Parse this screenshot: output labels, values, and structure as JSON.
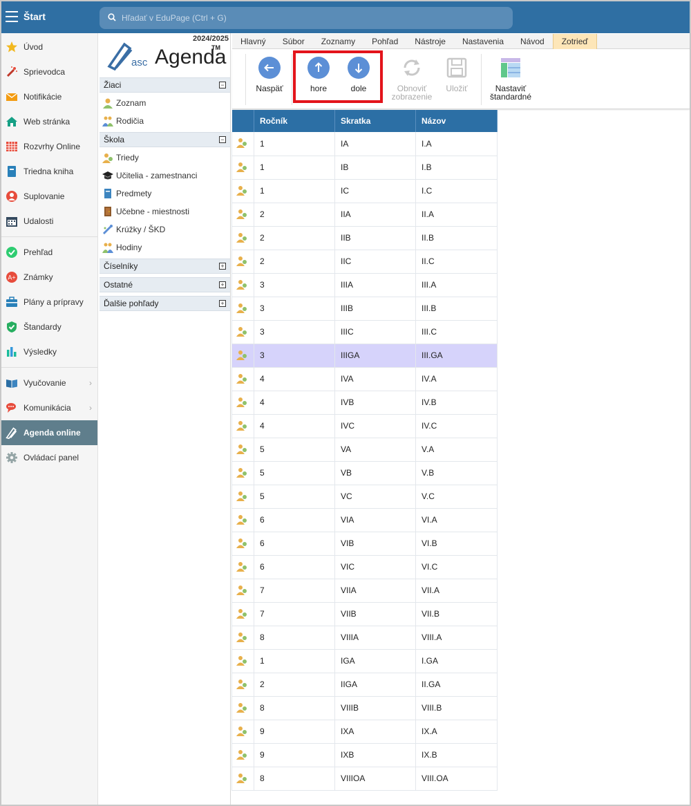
{
  "topbar": {
    "title": "Štart",
    "search_placeholder": "Hľadať v EduPage (Ctrl + G)"
  },
  "leftnav": {
    "items": [
      {
        "label": "Úvod",
        "icon": "star-icon"
      },
      {
        "label": "Sprievodca",
        "icon": "magic-wand-icon"
      },
      {
        "label": "Notifikácie",
        "icon": "envelope-icon"
      },
      {
        "label": "Web stránka",
        "icon": "home-icon"
      },
      {
        "label": "Rozvrhy Online",
        "icon": "grid-calendar-icon"
      },
      {
        "label": "Triedna kniha",
        "icon": "book-icon"
      },
      {
        "label": "Suplovanie",
        "icon": "substitute-person-icon"
      },
      {
        "label": "Udalosti",
        "icon": "calendar-icon"
      },
      {
        "label": "Prehľad",
        "icon": "check-circle-icon"
      },
      {
        "label": "Známky",
        "icon": "grades-icon"
      },
      {
        "label": "Plány a prípravy",
        "icon": "briefcase-icon"
      },
      {
        "label": "Štandardy",
        "icon": "shield-check-icon"
      },
      {
        "label": "Výsledky",
        "icon": "bar-chart-icon"
      },
      {
        "label": "Vyučovanie",
        "icon": "open-book-icon"
      },
      {
        "label": "Komunikácia",
        "icon": "chat-icon"
      },
      {
        "label": "Agenda online",
        "icon": "pen-icon"
      },
      {
        "label": "Ovládací panel",
        "icon": "gear-icon"
      }
    ]
  },
  "agenda": {
    "year": "2024/2025",
    "logo_small": "asc",
    "logo_big": "Agenda",
    "logo_tm": "TM",
    "groups": [
      {
        "label": "Žiaci",
        "toggle": "−"
      },
      {
        "label": "Škola",
        "toggle": "−"
      },
      {
        "label": "Číselníky",
        "toggle": "+"
      },
      {
        "label": "Ostatné",
        "toggle": "+"
      },
      {
        "label": "Ďalšie pohľady",
        "toggle": "+"
      }
    ],
    "ziaci_items": [
      {
        "label": "Zoznam",
        "icon": "student-icon"
      },
      {
        "label": "Rodičia",
        "icon": "parents-icon"
      }
    ],
    "skola_items": [
      {
        "label": "Triedy",
        "icon": "class-icon"
      },
      {
        "label": "Učitelia - zamestnanci",
        "icon": "graduation-cap-icon"
      },
      {
        "label": "Predmety",
        "icon": "subject-book-icon"
      },
      {
        "label": "Učebne - miestnosti",
        "icon": "door-icon"
      },
      {
        "label": "Krúžky / ŠKD",
        "icon": "club-icon"
      },
      {
        "label": "Hodiny",
        "icon": "lessons-icon"
      }
    ]
  },
  "tabs": [
    "Hlavný",
    "Súbor",
    "Zoznamy",
    "Pohľad",
    "Nástroje",
    "Nastavenia",
    "Návod",
    "Zotrieď"
  ],
  "toolbar": {
    "back_label": "Naspäť",
    "up_label": "hore",
    "down_label": "dole",
    "refresh_label_1": "Obnoviť",
    "refresh_label_2": "zobrazenie",
    "save_label": "Uložiť",
    "set_default_label_1": "Nastaviť",
    "set_default_label_2": "štandardné"
  },
  "table": {
    "headers": [
      "Ročník",
      "Skratka",
      "Názov"
    ],
    "rows": [
      [
        "1",
        "IA",
        "I.A"
      ],
      [
        "1",
        "IB",
        "I.B"
      ],
      [
        "1",
        "IC",
        "I.C"
      ],
      [
        "2",
        "IIA",
        "II.A"
      ],
      [
        "2",
        "IIB",
        "II.B"
      ],
      [
        "2",
        "IIC",
        "II.C"
      ],
      [
        "3",
        "IIIA",
        "III.A"
      ],
      [
        "3",
        "IIIB",
        "III.B"
      ],
      [
        "3",
        "IIIC",
        "III.C"
      ],
      [
        "3",
        "IIIGA",
        "III.GA"
      ],
      [
        "4",
        "IVA",
        "IV.A"
      ],
      [
        "4",
        "IVB",
        "IV.B"
      ],
      [
        "4",
        "IVC",
        "IV.C"
      ],
      [
        "5",
        "VA",
        "V.A"
      ],
      [
        "5",
        "VB",
        "V.B"
      ],
      [
        "5",
        "VC",
        "V.C"
      ],
      [
        "6",
        "VIA",
        "VI.A"
      ],
      [
        "6",
        "VIB",
        "VI.B"
      ],
      [
        "6",
        "VIC",
        "VI.C"
      ],
      [
        "7",
        "VIIA",
        "VII.A"
      ],
      [
        "7",
        "VIIB",
        "VII.B"
      ],
      [
        "8",
        "VIIIA",
        "VIII.A"
      ],
      [
        "1",
        "IGA",
        "I.GA"
      ],
      [
        "2",
        "IIGA",
        "II.GA"
      ],
      [
        "8",
        "VIIIB",
        "VIII.B"
      ],
      [
        "9",
        "IXA",
        "IX.A"
      ],
      [
        "9",
        "IXB",
        "IX.B"
      ],
      [
        "8",
        "VIIIOA",
        "VIII.OA"
      ]
    ],
    "selected_index": 9
  },
  "colors": {
    "topbar": "#2f6fa3",
    "table_header": "#2c6fa5",
    "selected_row": "#d6d3fb",
    "active_nav": "#5f7e8c",
    "active_tab": "#fde6b8",
    "highlight_box": "#e3141b"
  }
}
